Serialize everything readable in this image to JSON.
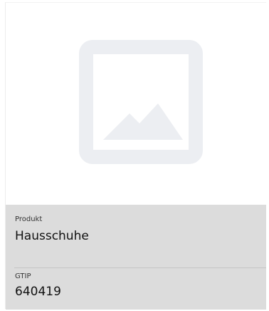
{
  "product_card": {
    "image": {
      "icon": "image-placeholder-icon"
    },
    "product": {
      "label": "Produkt",
      "value": "Hausschuhe"
    },
    "gtip": {
      "label": "GTIP",
      "value": "640419"
    }
  },
  "colors": {
    "info_background": "#dcdcdc",
    "placeholder": "#eceef2"
  }
}
